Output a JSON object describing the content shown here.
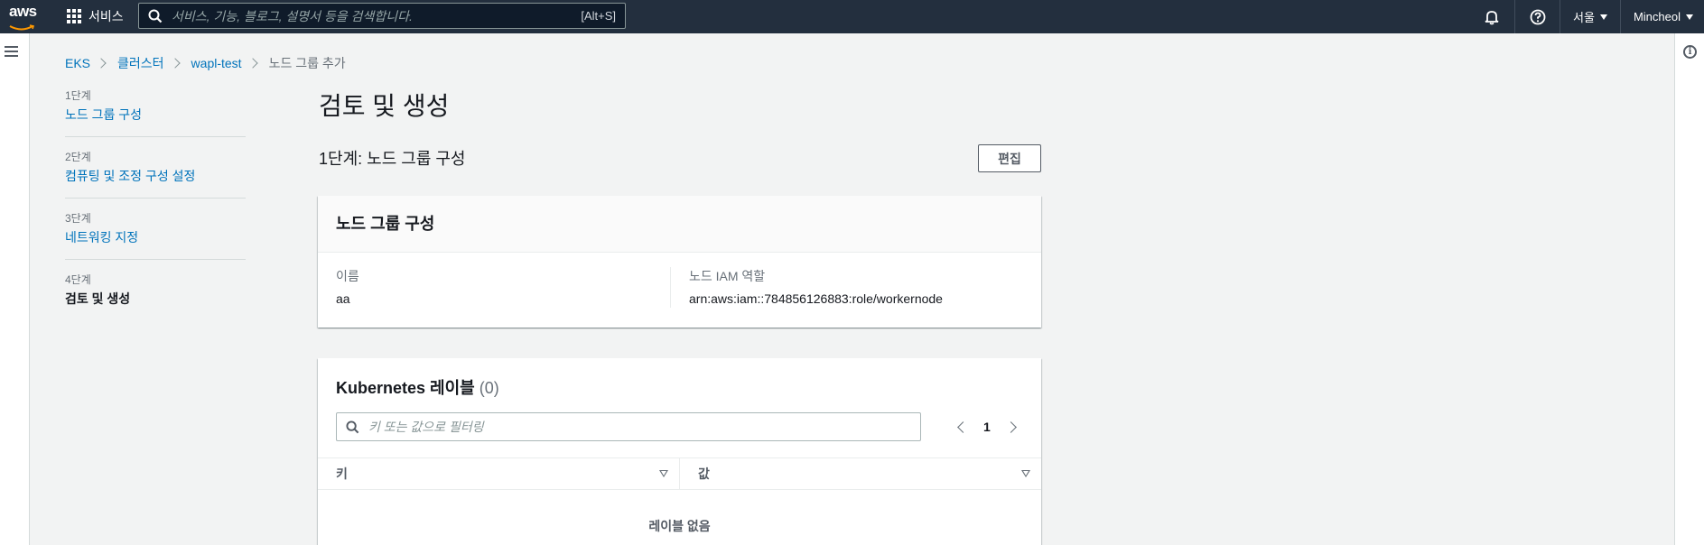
{
  "topnav": {
    "logo_text": "aws",
    "services_label": "서비스",
    "search_placeholder": "서비스, 기능, 블로그, 설명서 등을 검색합니다.",
    "search_shortcut": "[Alt+S]",
    "region_label": "서울",
    "user_label": "Mincheol"
  },
  "breadcrumb": {
    "items": [
      "EKS",
      "클러스터",
      "wapl-test"
    ],
    "current": "노드 그룹 추가"
  },
  "steps": [
    {
      "num": "1단계",
      "label": "노드 그룹 구성"
    },
    {
      "num": "2단계",
      "label": "컴퓨팅 및 조정 구성 설정"
    },
    {
      "num": "3단계",
      "label": "네트워킹 지정"
    },
    {
      "num": "4단계",
      "label": "검토 및 생성"
    }
  ],
  "main": {
    "page_title": "검토 및 생성",
    "section_title": "1단계: 노드 그룹 구성",
    "edit_label": "편집"
  },
  "nodegroup_card": {
    "title": "노드 그룹 구성",
    "name_label": "이름",
    "name_value": "aa",
    "role_label": "노드 IAM 역할",
    "role_value": "arn:aws:iam::784856126883:role/workernode"
  },
  "labels_card": {
    "title": "Kubernetes 레이블",
    "count": "(0)",
    "filter_placeholder": "키 또는 값으로 필터링",
    "page": "1",
    "col_key": "키",
    "col_value": "값",
    "empty_title": "레이블 없음",
    "empty_sub": ""
  },
  "colors": {
    "nav_bg": "#232f3e",
    "link": "#0073bb",
    "page_bg": "#f2f3f3"
  }
}
